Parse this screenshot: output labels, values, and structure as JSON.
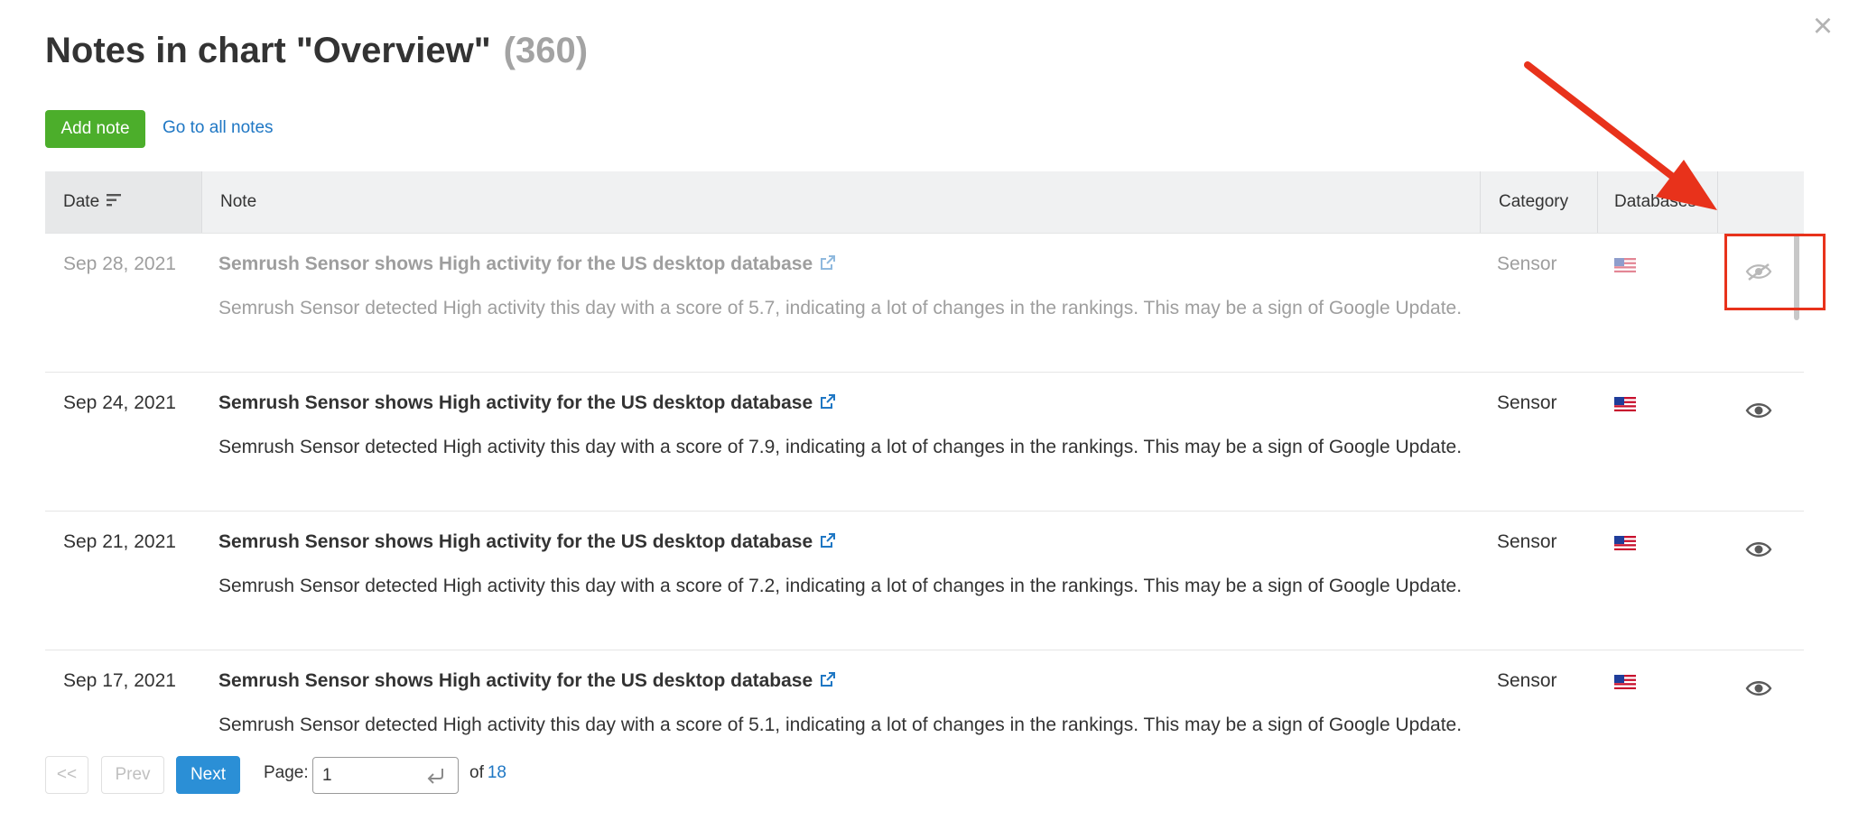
{
  "modal": {
    "close_label": "×",
    "title": "Notes in chart \"Overview\"",
    "count": "(360)"
  },
  "toolbar": {
    "add_note_label": "Add note",
    "all_notes_label": "Go to all notes"
  },
  "table": {
    "headers": {
      "date": "Date",
      "note": "Note",
      "category": "Category",
      "databases": "Databases"
    },
    "rows": [
      {
        "date": "Sep 28, 2021",
        "title": "Semrush Sensor shows High activity for the US desktop database",
        "description": "Semrush Sensor detected High activity this day with a score of 5.7, indicating a lot of changes in the rankings. This may be a sign of Google Update.",
        "category": "Sensor",
        "database_icon": "us-flag-icon",
        "visibility_icon": "eye-off-icon",
        "hidden": true
      },
      {
        "date": "Sep 24, 2021",
        "title": "Semrush Sensor shows High activity for the US desktop database",
        "description": "Semrush Sensor detected High activity this day with a score of 7.9, indicating a lot of changes in the rankings. This may be a sign of Google Update.",
        "category": "Sensor",
        "database_icon": "us-flag-icon",
        "visibility_icon": "eye-icon",
        "hidden": false
      },
      {
        "date": "Sep 21, 2021",
        "title": "Semrush Sensor shows High activity for the US desktop database",
        "description": "Semrush Sensor detected High activity this day with a score of 7.2, indicating a lot of changes in the rankings. This may be a sign of Google Update.",
        "category": "Sensor",
        "database_icon": "us-flag-icon",
        "visibility_icon": "eye-icon",
        "hidden": false
      },
      {
        "date": "Sep 17, 2021",
        "title": "Semrush Sensor shows High activity for the US desktop database",
        "description": "Semrush Sensor detected High activity this day with a score of 5.1, indicating a lot of changes in the rankings. This may be a sign of Google Update.",
        "category": "Sensor",
        "database_icon": "us-flag-icon",
        "visibility_icon": "eye-icon",
        "hidden": false
      }
    ]
  },
  "pagination": {
    "first_label": "<<",
    "prev_label": "Prev",
    "next_label": "Next",
    "page_label": "Page:",
    "current_page": "1",
    "of_label": "of",
    "total_pages": "18"
  },
  "colors": {
    "accent_green": "#4cae2b",
    "accent_blue": "#2b8fd6",
    "link_blue": "#1f77c4",
    "annotation_red": "#e8321b"
  }
}
